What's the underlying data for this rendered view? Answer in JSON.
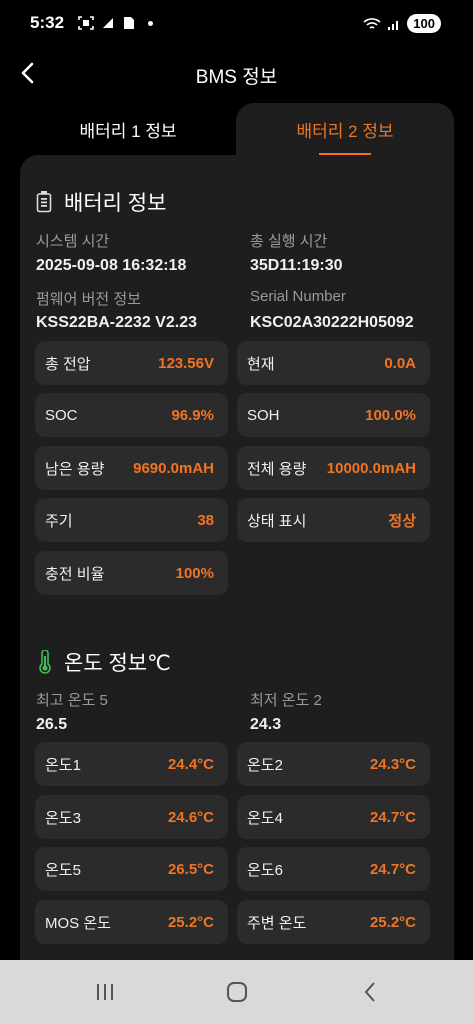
{
  "status": {
    "time": "5:32",
    "battery": "100"
  },
  "header": {
    "title": "BMS 정보"
  },
  "tabs": [
    {
      "label": "배터리 1 정보"
    },
    {
      "label": "배터리 2 정보"
    }
  ],
  "battery": {
    "title": "배터리 정보",
    "system_time_label": "시스템 시간",
    "system_time": "2025-09-08 16:32:18",
    "total_runtime_label": "총 실행 시간",
    "total_runtime": "35D11:19:30",
    "firmware_label": "펌웨어 버전 정보",
    "firmware": "KSS22BA-2232 V2.23",
    "serial_label": "Serial Number",
    "serial": "KSC02A30222H05092",
    "cards": [
      {
        "k": "총 전압",
        "v": "123.56V"
      },
      {
        "k": "현재",
        "v": "0.0A"
      },
      {
        "k": "SOC",
        "v": "96.9%"
      },
      {
        "k": "SOH",
        "v": "100.0%"
      },
      {
        "k": "남은 용량",
        "v": "9690.0mAH"
      },
      {
        "k": "전체 용량",
        "v": "10000.0mAH"
      },
      {
        "k": "주기",
        "v": "38"
      },
      {
        "k": "상태 표시",
        "v": "정상"
      },
      {
        "k": "충전 비율",
        "v": "100%"
      }
    ]
  },
  "temperature": {
    "title": "온도 정보℃",
    "max_label": "최고 온도 5",
    "max_value": "26.5",
    "min_label": "최저 온도 2",
    "min_value": "24.3",
    "cards": [
      {
        "k": "온도1",
        "v": "24.4°C"
      },
      {
        "k": "온도2",
        "v": "24.3°C"
      },
      {
        "k": "온도3",
        "v": "24.6°C"
      },
      {
        "k": "온도4",
        "v": "24.7°C"
      },
      {
        "k": "온도5",
        "v": "26.5°C"
      },
      {
        "k": "온도6",
        "v": "24.7°C"
      },
      {
        "k": "MOS 온도",
        "v": "25.2°C"
      },
      {
        "k": "주변 온도",
        "v": "25.2°C"
      }
    ]
  },
  "colors": {
    "accent": "#f07424",
    "panel": "#1e1e1e",
    "card": "#2b2b2b",
    "thermo": "#3fbf5a"
  }
}
